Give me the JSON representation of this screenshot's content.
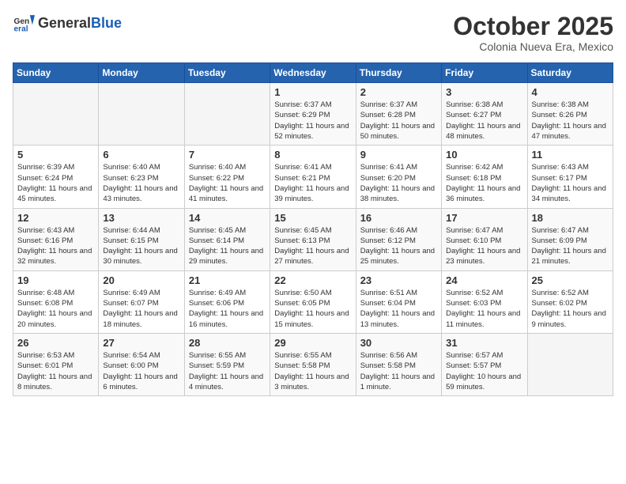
{
  "header": {
    "logo_general": "General",
    "logo_blue": "Blue",
    "month_title": "October 2025",
    "subtitle": "Colonia Nueva Era, Mexico"
  },
  "weekdays": [
    "Sunday",
    "Monday",
    "Tuesday",
    "Wednesday",
    "Thursday",
    "Friday",
    "Saturday"
  ],
  "weeks": [
    [
      {
        "day": "",
        "sunrise": "",
        "sunset": "",
        "daylight": ""
      },
      {
        "day": "",
        "sunrise": "",
        "sunset": "",
        "daylight": ""
      },
      {
        "day": "",
        "sunrise": "",
        "sunset": "",
        "daylight": ""
      },
      {
        "day": "1",
        "sunrise": "Sunrise: 6:37 AM",
        "sunset": "Sunset: 6:29 PM",
        "daylight": "Daylight: 11 hours and 52 minutes."
      },
      {
        "day": "2",
        "sunrise": "Sunrise: 6:37 AM",
        "sunset": "Sunset: 6:28 PM",
        "daylight": "Daylight: 11 hours and 50 minutes."
      },
      {
        "day": "3",
        "sunrise": "Sunrise: 6:38 AM",
        "sunset": "Sunset: 6:27 PM",
        "daylight": "Daylight: 11 hours and 48 minutes."
      },
      {
        "day": "4",
        "sunrise": "Sunrise: 6:38 AM",
        "sunset": "Sunset: 6:26 PM",
        "daylight": "Daylight: 11 hours and 47 minutes."
      }
    ],
    [
      {
        "day": "5",
        "sunrise": "Sunrise: 6:39 AM",
        "sunset": "Sunset: 6:24 PM",
        "daylight": "Daylight: 11 hours and 45 minutes."
      },
      {
        "day": "6",
        "sunrise": "Sunrise: 6:40 AM",
        "sunset": "Sunset: 6:23 PM",
        "daylight": "Daylight: 11 hours and 43 minutes."
      },
      {
        "day": "7",
        "sunrise": "Sunrise: 6:40 AM",
        "sunset": "Sunset: 6:22 PM",
        "daylight": "Daylight: 11 hours and 41 minutes."
      },
      {
        "day": "8",
        "sunrise": "Sunrise: 6:41 AM",
        "sunset": "Sunset: 6:21 PM",
        "daylight": "Daylight: 11 hours and 39 minutes."
      },
      {
        "day": "9",
        "sunrise": "Sunrise: 6:41 AM",
        "sunset": "Sunset: 6:20 PM",
        "daylight": "Daylight: 11 hours and 38 minutes."
      },
      {
        "day": "10",
        "sunrise": "Sunrise: 6:42 AM",
        "sunset": "Sunset: 6:18 PM",
        "daylight": "Daylight: 11 hours and 36 minutes."
      },
      {
        "day": "11",
        "sunrise": "Sunrise: 6:43 AM",
        "sunset": "Sunset: 6:17 PM",
        "daylight": "Daylight: 11 hours and 34 minutes."
      }
    ],
    [
      {
        "day": "12",
        "sunrise": "Sunrise: 6:43 AM",
        "sunset": "Sunset: 6:16 PM",
        "daylight": "Daylight: 11 hours and 32 minutes."
      },
      {
        "day": "13",
        "sunrise": "Sunrise: 6:44 AM",
        "sunset": "Sunset: 6:15 PM",
        "daylight": "Daylight: 11 hours and 30 minutes."
      },
      {
        "day": "14",
        "sunrise": "Sunrise: 6:45 AM",
        "sunset": "Sunset: 6:14 PM",
        "daylight": "Daylight: 11 hours and 29 minutes."
      },
      {
        "day": "15",
        "sunrise": "Sunrise: 6:45 AM",
        "sunset": "Sunset: 6:13 PM",
        "daylight": "Daylight: 11 hours and 27 minutes."
      },
      {
        "day": "16",
        "sunrise": "Sunrise: 6:46 AM",
        "sunset": "Sunset: 6:12 PM",
        "daylight": "Daylight: 11 hours and 25 minutes."
      },
      {
        "day": "17",
        "sunrise": "Sunrise: 6:47 AM",
        "sunset": "Sunset: 6:10 PM",
        "daylight": "Daylight: 11 hours and 23 minutes."
      },
      {
        "day": "18",
        "sunrise": "Sunrise: 6:47 AM",
        "sunset": "Sunset: 6:09 PM",
        "daylight": "Daylight: 11 hours and 21 minutes."
      }
    ],
    [
      {
        "day": "19",
        "sunrise": "Sunrise: 6:48 AM",
        "sunset": "Sunset: 6:08 PM",
        "daylight": "Daylight: 11 hours and 20 minutes."
      },
      {
        "day": "20",
        "sunrise": "Sunrise: 6:49 AM",
        "sunset": "Sunset: 6:07 PM",
        "daylight": "Daylight: 11 hours and 18 minutes."
      },
      {
        "day": "21",
        "sunrise": "Sunrise: 6:49 AM",
        "sunset": "Sunset: 6:06 PM",
        "daylight": "Daylight: 11 hours and 16 minutes."
      },
      {
        "day": "22",
        "sunrise": "Sunrise: 6:50 AM",
        "sunset": "Sunset: 6:05 PM",
        "daylight": "Daylight: 11 hours and 15 minutes."
      },
      {
        "day": "23",
        "sunrise": "Sunrise: 6:51 AM",
        "sunset": "Sunset: 6:04 PM",
        "daylight": "Daylight: 11 hours and 13 minutes."
      },
      {
        "day": "24",
        "sunrise": "Sunrise: 6:52 AM",
        "sunset": "Sunset: 6:03 PM",
        "daylight": "Daylight: 11 hours and 11 minutes."
      },
      {
        "day": "25",
        "sunrise": "Sunrise: 6:52 AM",
        "sunset": "Sunset: 6:02 PM",
        "daylight": "Daylight: 11 hours and 9 minutes."
      }
    ],
    [
      {
        "day": "26",
        "sunrise": "Sunrise: 6:53 AM",
        "sunset": "Sunset: 6:01 PM",
        "daylight": "Daylight: 11 hours and 8 minutes."
      },
      {
        "day": "27",
        "sunrise": "Sunrise: 6:54 AM",
        "sunset": "Sunset: 6:00 PM",
        "daylight": "Daylight: 11 hours and 6 minutes."
      },
      {
        "day": "28",
        "sunrise": "Sunrise: 6:55 AM",
        "sunset": "Sunset: 5:59 PM",
        "daylight": "Daylight: 11 hours and 4 minutes."
      },
      {
        "day": "29",
        "sunrise": "Sunrise: 6:55 AM",
        "sunset": "Sunset: 5:58 PM",
        "daylight": "Daylight: 11 hours and 3 minutes."
      },
      {
        "day": "30",
        "sunrise": "Sunrise: 6:56 AM",
        "sunset": "Sunset: 5:58 PM",
        "daylight": "Daylight: 11 hours and 1 minute."
      },
      {
        "day": "31",
        "sunrise": "Sunrise: 6:57 AM",
        "sunset": "Sunset: 5:57 PM",
        "daylight": "Daylight: 10 hours and 59 minutes."
      },
      {
        "day": "",
        "sunrise": "",
        "sunset": "",
        "daylight": ""
      }
    ]
  ]
}
